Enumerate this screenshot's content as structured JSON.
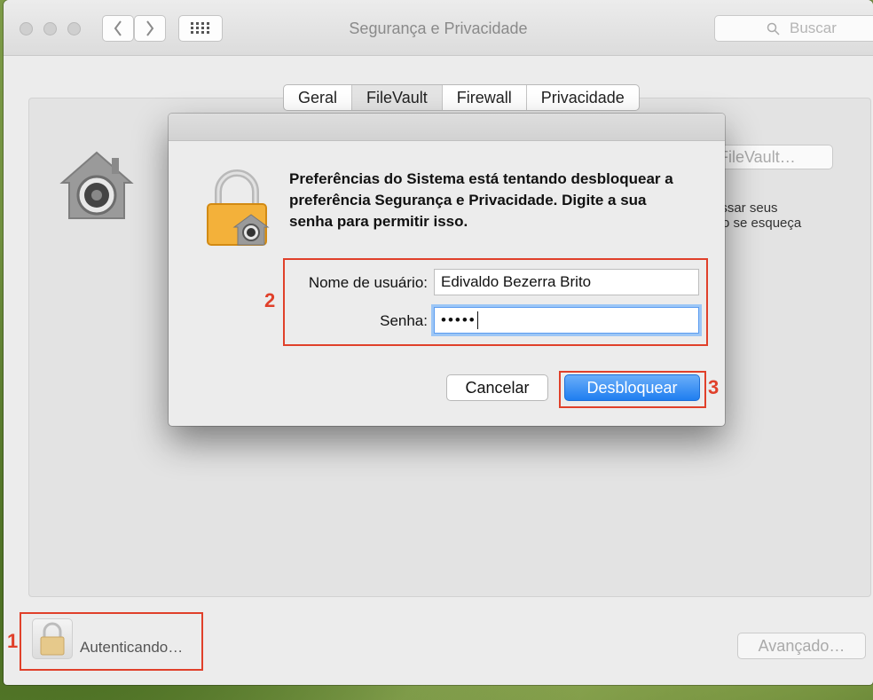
{
  "window": {
    "title": "Segurança e Privacidade"
  },
  "search": {
    "placeholder": "Buscar"
  },
  "tabs": [
    {
      "label": "Geral"
    },
    {
      "label": "FileVault"
    },
    {
      "label": "Firewall"
    },
    {
      "label": "Privacidade"
    }
  ],
  "background_panel": {
    "filevault_button": "FileVault…",
    "peek_text_1": "essar seus",
    "peek_text_2": "o se esqueça"
  },
  "footer": {
    "auth_status": "Autenticando…",
    "advanced_button": "Avançado…"
  },
  "dialog": {
    "message": "Preferências do Sistema está tentando desbloquear a preferência Segurança e Privacidade. Digite a sua senha para permitir isso.",
    "username_label": "Nome de usuário:",
    "username_value": "Edivaldo Bezerra Brito",
    "password_label": "Senha:",
    "password_value": "•••••",
    "cancel_button": "Cancelar",
    "unlock_button": "Desbloquear"
  },
  "annotations": {
    "n1": "1",
    "n2": "2",
    "n3": "3"
  },
  "colors": {
    "accent": "#1f7ef0",
    "highlight": "#e0402a"
  }
}
